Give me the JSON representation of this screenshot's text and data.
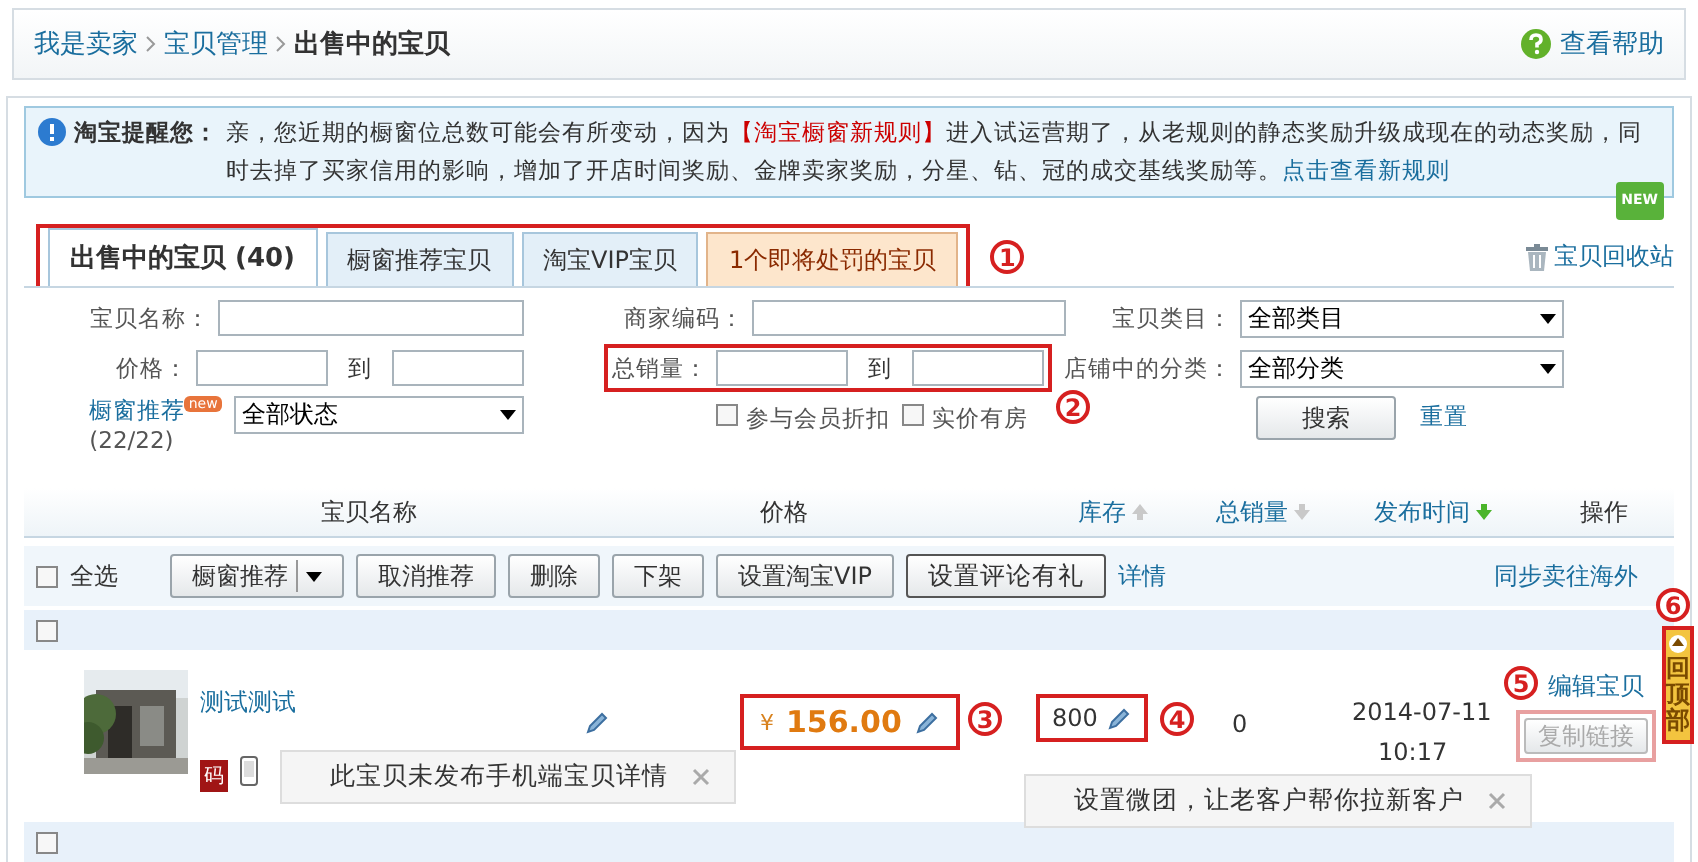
{
  "breadcrumb": [
    "我是卖家",
    "宝贝管理",
    "出售中的宝贝"
  ],
  "help": "查看帮助",
  "notice": {
    "title": "淘宝提醒您：",
    "parts": [
      {
        "kind": "text",
        "text": "亲，您近期的橱窗位总数可能会有所变动，因为"
      },
      {
        "kind": "highlight",
        "text": "【淘宝橱窗新规则】"
      },
      {
        "kind": "text",
        "text": "进入试运营期了，从老规则的静态奖励升级成现在的动态奖励，同时去掉了买家信用的影响，增加了开店时间奖励、金牌卖家奖励，分星、钻、冠的成交基线奖励等。"
      },
      {
        "kind": "link",
        "text": "点击查看新规则"
      }
    ],
    "badge": "NEW"
  },
  "tabs": [
    {
      "label": "出售中的宝贝 (40)",
      "selected": true,
      "kind": "normal"
    },
    {
      "label": "橱窗推荐宝贝",
      "selected": false,
      "kind": "normal"
    },
    {
      "label": "淘宝VIP宝贝",
      "selected": false,
      "kind": "normal"
    },
    {
      "label": "1个即将处罚的宝贝",
      "selected": false,
      "kind": "warning"
    }
  ],
  "tabs_marker": "1",
  "recycle": "宝贝回收站",
  "filters": {
    "name_label": "宝贝名称：",
    "price_label": "价格：",
    "to": "到",
    "code_label": "商家编码：",
    "sales_label": "总销量：",
    "sales_to": "到",
    "sales_marker": "2",
    "category_label": "宝贝类目：",
    "category_value": "全部类目",
    "shop_label": "店铺中的分类：",
    "shop_value": "全部分类",
    "window_label": "橱窗推荐",
    "window_badge": "new",
    "window_count": "(22/22)",
    "window_value": "全部状态",
    "checks": [
      {
        "label": "参与会员折扣",
        "checked": false
      },
      {
        "label": "实价有房",
        "checked": false
      }
    ],
    "search": "搜索",
    "reset": "重置"
  },
  "columns": [
    {
      "label": "宝贝名称",
      "kind": "plain"
    },
    {
      "label": "价格",
      "kind": "plain"
    },
    {
      "label": "库存",
      "kind": "ascending",
      "active": false
    },
    {
      "label": "总销量",
      "kind": "descending",
      "active": false
    },
    {
      "label": "发布时间",
      "kind": "descending",
      "active": true
    },
    {
      "label": "操作",
      "kind": "plain"
    }
  ],
  "toolbar": {
    "select_all": "全选",
    "checked": false,
    "buttons": [
      {
        "label": "橱窗推荐",
        "kind": "dropdown"
      },
      {
        "label": "取消推荐",
        "kind": "normal"
      },
      {
        "label": "删除",
        "kind": "normal"
      },
      {
        "label": "下架",
        "kind": "normal"
      },
      {
        "label": "设置淘宝VIP",
        "kind": "normal"
      },
      {
        "label": "设置评论有礼",
        "kind": "primary"
      }
    ],
    "details": "详情",
    "sync": "同步卖往海外"
  },
  "item": {
    "checked_top": false,
    "title": "测试测试",
    "code_badge": "码",
    "currency": "¥",
    "price": "156.00",
    "price_marker": "3",
    "stock": "800",
    "stock_marker": "4",
    "sales": "0",
    "date": "2014-07-11",
    "time": "10:17",
    "edit": "编辑宝贝",
    "edit_marker": "5",
    "copy": "复制链接",
    "copy_disabled": true,
    "tip_mobile": "此宝贝未发布手机端宝贝详情",
    "tip_group": "设置微团，让老客户帮你拉新客户",
    "checked_bottom": false
  },
  "back_to_top": {
    "label": "回顶部",
    "marker": "6"
  }
}
